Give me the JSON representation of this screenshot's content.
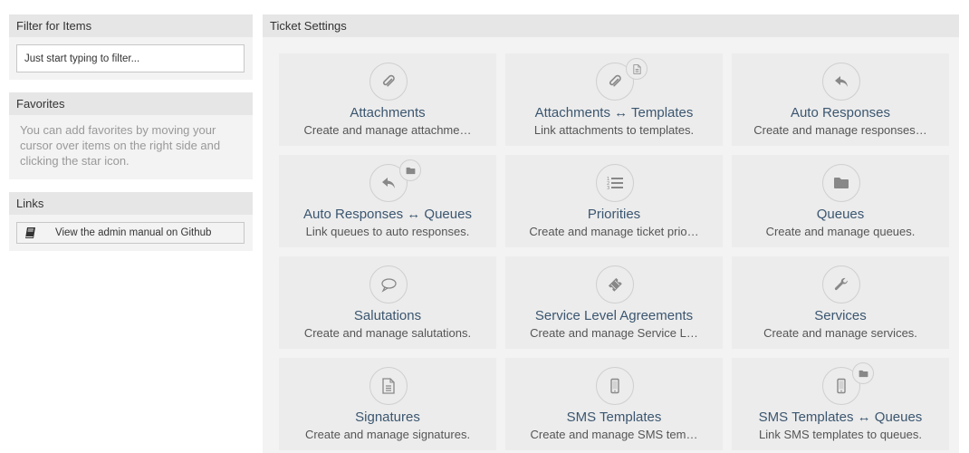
{
  "sidebar": {
    "filter": {
      "title": "Filter for Items",
      "placeholder": "Just start typing to filter..."
    },
    "favorites": {
      "title": "Favorites",
      "text": "You can add favorites by moving your cursor over items on the right side and clicking the star icon."
    },
    "links": {
      "title": "Links",
      "button_label": "View the admin manual on Github",
      "button_icon": "book-icon"
    }
  },
  "main": {
    "title": "Ticket Settings",
    "tiles": [
      {
        "title": "Attachments",
        "desc": "Create and manage attachme…",
        "icon": "paperclip-icon",
        "sub_icon": null
      },
      {
        "title": "Attachments ↔ Templates",
        "desc": "Link attachments to templates.",
        "icon": "paperclip-icon",
        "sub_icon": "document-icon"
      },
      {
        "title": "Auto Responses",
        "desc": "Create and manage responses…",
        "icon": "reply-icon",
        "sub_icon": null
      },
      {
        "title": "Auto Responses ↔ Queues",
        "desc": "Link queues to auto responses.",
        "icon": "reply-icon",
        "sub_icon": "folder-icon"
      },
      {
        "title": "Priorities",
        "desc": "Create and manage ticket prio…",
        "icon": "ordered-list-icon",
        "sub_icon": null
      },
      {
        "title": "Queues",
        "desc": "Create and manage queues.",
        "icon": "folder-icon",
        "sub_icon": null
      },
      {
        "title": "Salutations",
        "desc": "Create and manage salutations.",
        "icon": "speech-bubble-icon",
        "sub_icon": null
      },
      {
        "title": "Service Level Agreements",
        "desc": "Create and manage Service L…",
        "icon": "ticket-icon",
        "sub_icon": null
      },
      {
        "title": "Services",
        "desc": "Create and manage services.",
        "icon": "wrench-icon",
        "sub_icon": null
      },
      {
        "title": "Signatures",
        "desc": "Create and manage signatures.",
        "icon": "document-icon",
        "sub_icon": null
      },
      {
        "title": "SMS Templates",
        "desc": "Create and manage SMS tem…",
        "icon": "mobile-icon",
        "sub_icon": null
      },
      {
        "title": "SMS Templates ↔ Queues",
        "desc": "Link SMS templates to queues.",
        "icon": "mobile-icon",
        "sub_icon": "folder-icon"
      }
    ]
  }
}
